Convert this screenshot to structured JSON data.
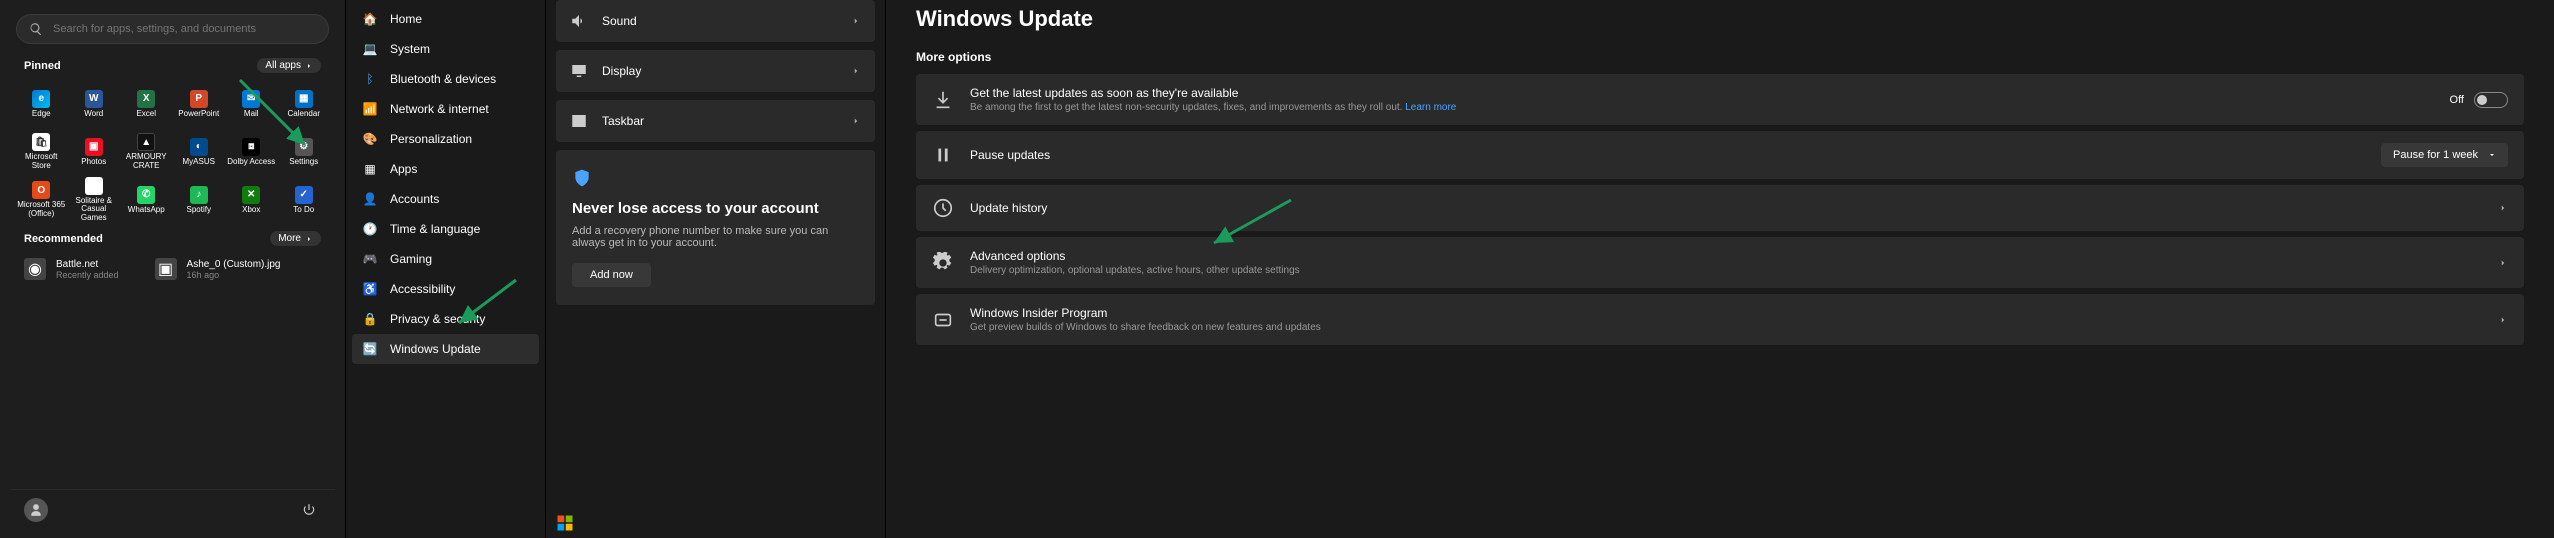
{
  "start_menu": {
    "search_placeholder": "Search for apps, settings, and documents",
    "pinned_label": "Pinned",
    "all_apps_label": "All apps",
    "recommended_label": "Recommended",
    "more_label": "More",
    "apps": [
      {
        "name": "Edge"
      },
      {
        "name": "Word"
      },
      {
        "name": "Excel"
      },
      {
        "name": "PowerPoint"
      },
      {
        "name": "Mail"
      },
      {
        "name": "Calendar"
      },
      {
        "name": "Microsoft Store"
      },
      {
        "name": "Photos"
      },
      {
        "name": "ARMOURY CRATE"
      },
      {
        "name": "MyASUS"
      },
      {
        "name": "Dolby Access"
      },
      {
        "name": "Settings"
      },
      {
        "name": "Microsoft 365 (Office)"
      },
      {
        "name": "Solitaire & Casual Games"
      },
      {
        "name": "WhatsApp"
      },
      {
        "name": "Spotify"
      },
      {
        "name": "Xbox"
      },
      {
        "name": "To Do"
      }
    ],
    "recommended": [
      {
        "name": "Battle.net",
        "sub": "Recently added"
      },
      {
        "name": "Ashe_0 (Custom).jpg",
        "sub": "16h ago"
      }
    ]
  },
  "settings_nav": [
    {
      "label": "Home",
      "icon": "🏠"
    },
    {
      "label": "System",
      "icon": "💻"
    },
    {
      "label": "Bluetooth & devices",
      "icon": "ᛒ"
    },
    {
      "label": "Network & internet",
      "icon": "📶"
    },
    {
      "label": "Personalization",
      "icon": "🎨"
    },
    {
      "label": "Apps",
      "icon": "▦"
    },
    {
      "label": "Accounts",
      "icon": "👤"
    },
    {
      "label": "Time & language",
      "icon": "🕐"
    },
    {
      "label": "Gaming",
      "icon": "🎮"
    },
    {
      "label": "Accessibility",
      "icon": "♿"
    },
    {
      "label": "Privacy & security",
      "icon": "🔒"
    },
    {
      "label": "Windows Update",
      "icon": "🔄"
    }
  ],
  "system_panel": {
    "items": [
      {
        "label": "Sound"
      },
      {
        "label": "Display"
      },
      {
        "label": "Taskbar"
      }
    ],
    "card": {
      "title": "Never lose access to your account",
      "body": "Add a recovery phone number to make sure you can always get in to your account.",
      "button": "Add now"
    }
  },
  "windows_update": {
    "title": "Windows Update",
    "more_options": "More options",
    "toggle_off": "Off",
    "pause_dropdown": "Pause for 1 week",
    "learn_more": "Learn more",
    "cards": [
      {
        "title": "Get the latest updates as soon as they're available",
        "sub": "Be among the first to get the latest non-security updates, fixes, and improvements as they roll out."
      },
      {
        "title": "Pause updates"
      },
      {
        "title": "Update history"
      },
      {
        "title": "Advanced options",
        "sub": "Delivery optimization, optional updates, active hours, other update settings"
      },
      {
        "title": "Windows Insider Program",
        "sub": "Get preview builds of Windows to share feedback on new features and updates"
      }
    ]
  }
}
